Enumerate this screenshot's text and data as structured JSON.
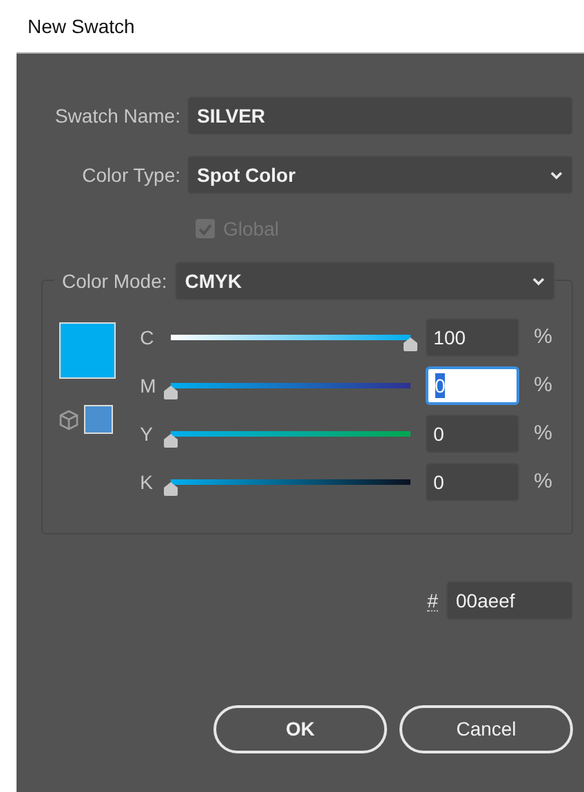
{
  "window": {
    "title": "New Swatch"
  },
  "swatch_name": {
    "label": "Swatch Name:",
    "value": "SILVER"
  },
  "color_type": {
    "label": "Color Type:",
    "value": "Spot Color"
  },
  "global": {
    "label": "Global",
    "checked": true,
    "disabled": true
  },
  "color_mode": {
    "label": "Color Mode:",
    "value": "CMYK"
  },
  "gamut_swatch": {
    "color": "#4a8fcf"
  },
  "channels": [
    {
      "label": "C",
      "level": 1,
      "value": "100",
      "unit": "%",
      "focused": false
    },
    {
      "label": "M",
      "level": 0,
      "value": "0",
      "unit": "%",
      "focused": true
    },
    {
      "label": "Y",
      "level": 0,
      "value": "0",
      "unit": "%",
      "focused": false
    },
    {
      "label": "K",
      "level": 0,
      "value": "0",
      "unit": "%",
      "focused": false
    }
  ],
  "hex": {
    "label": "#",
    "value": "00aeef"
  },
  "buttons": [
    "OK",
    "Cancel"
  ]
}
